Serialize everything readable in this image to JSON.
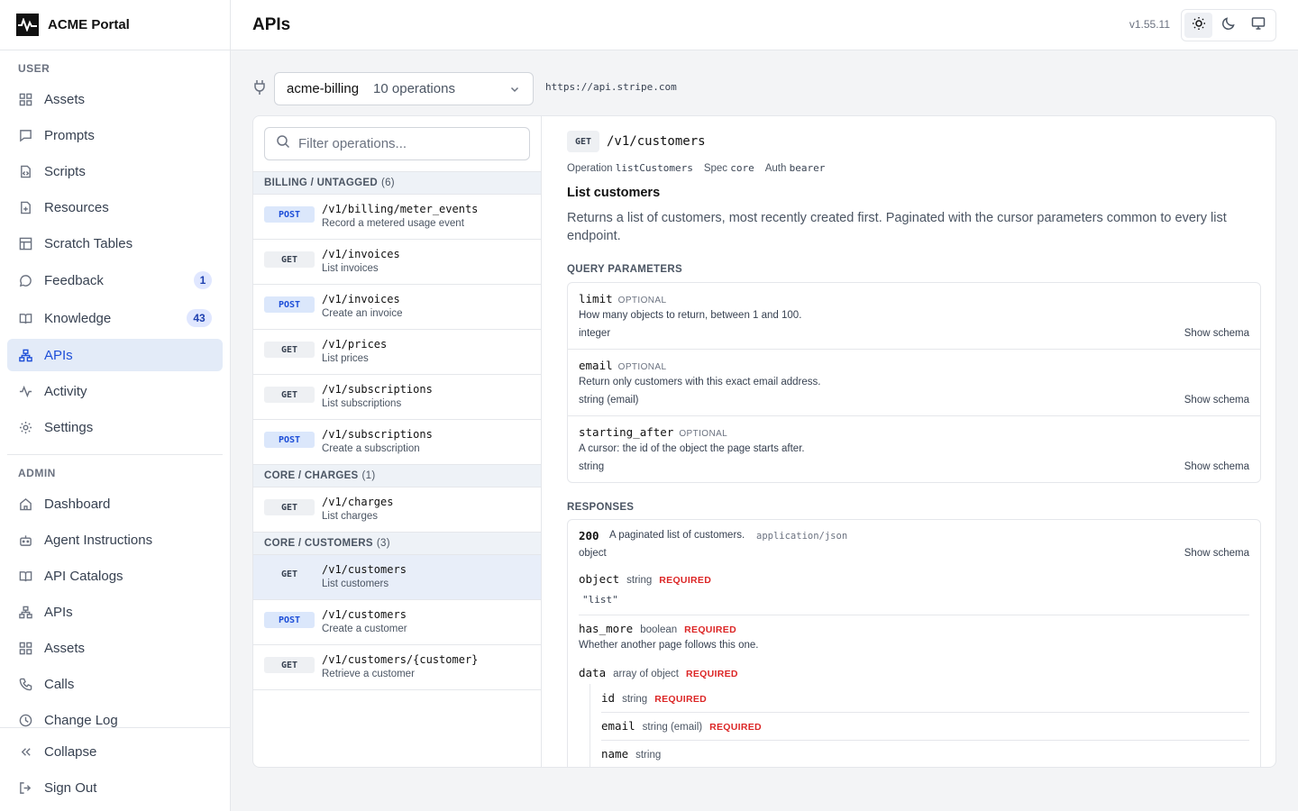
{
  "app": {
    "name": "ACME Portal",
    "version": "v1.55.11"
  },
  "sidebar": {
    "user_label": "USER",
    "admin_label": "ADMIN",
    "user_items": [
      {
        "label": "Assets",
        "icon": "grid-icon"
      },
      {
        "label": "Prompts",
        "icon": "message-square-icon"
      },
      {
        "label": "Scripts",
        "icon": "file-code-icon"
      },
      {
        "label": "Resources",
        "icon": "file-plus-icon"
      },
      {
        "label": "Scratch Tables",
        "icon": "table-icon"
      },
      {
        "label": "Feedback",
        "icon": "message-circle-icon",
        "badge": "1"
      },
      {
        "label": "Knowledge",
        "icon": "book-open-icon",
        "badge": "43"
      },
      {
        "label": "APIs",
        "icon": "network-icon",
        "active": true
      },
      {
        "label": "Activity",
        "icon": "activity-icon"
      },
      {
        "label": "Settings",
        "icon": "gear-icon"
      }
    ],
    "admin_items": [
      {
        "label": "Dashboard",
        "icon": "home-icon"
      },
      {
        "label": "Agent Instructions",
        "icon": "bot-icon"
      },
      {
        "label": "API Catalogs",
        "icon": "book-open-icon"
      },
      {
        "label": "APIs",
        "icon": "network-icon"
      },
      {
        "label": "Assets",
        "icon": "grid-icon"
      },
      {
        "label": "Calls",
        "icon": "phone-icon"
      },
      {
        "label": "Change Log",
        "icon": "clock-icon"
      }
    ],
    "collapse_label": "Collapse",
    "signout_label": "Sign Out"
  },
  "header": {
    "title": "APIs"
  },
  "toolbar": {
    "catalog_name": "acme-billing",
    "catalog_ops": "10 operations",
    "base_url": "https://api.stripe.com"
  },
  "operations": {
    "filter_placeholder": "Filter operations...",
    "groups": [
      {
        "name": "BILLING / UNTAGGED",
        "count": "(6)",
        "ops": [
          {
            "method": "POST",
            "path": "/v1/billing/meter_events",
            "summary": "Record a metered usage event"
          },
          {
            "method": "GET",
            "path": "/v1/invoices",
            "summary": "List invoices"
          },
          {
            "method": "POST",
            "path": "/v1/invoices",
            "summary": "Create an invoice"
          },
          {
            "method": "GET",
            "path": "/v1/prices",
            "summary": "List prices"
          },
          {
            "method": "GET",
            "path": "/v1/subscriptions",
            "summary": "List subscriptions"
          },
          {
            "method": "POST",
            "path": "/v1/subscriptions",
            "summary": "Create a subscription"
          }
        ]
      },
      {
        "name": "CORE / CHARGES",
        "count": "(1)",
        "ops": [
          {
            "method": "GET",
            "path": "/v1/charges",
            "summary": "List charges"
          }
        ]
      },
      {
        "name": "CORE / CUSTOMERS",
        "count": "(3)",
        "ops": [
          {
            "method": "GET",
            "path": "/v1/customers",
            "summary": "List customers",
            "selected": true
          },
          {
            "method": "POST",
            "path": "/v1/customers",
            "summary": "Create a customer"
          },
          {
            "method": "GET",
            "path": "/v1/customers/{customer}",
            "summary": "Retrieve a customer"
          }
        ]
      }
    ]
  },
  "detail": {
    "method": "GET",
    "path": "/v1/customers",
    "operation_label": "Operation",
    "operation_id": "listCustomers",
    "spec_label": "Spec",
    "spec": "core",
    "auth_label": "Auth",
    "auth": "bearer",
    "title": "List customers",
    "description": "Returns a list of customers, most recently created first. Paginated with the cursor parameters common to every list endpoint.",
    "query_label": "QUERY PARAMETERS",
    "show_schema": "Show schema",
    "params": [
      {
        "name": "limit",
        "flag": "OPTIONAL",
        "desc": "How many objects to return, between 1 and 100.",
        "type": "integer"
      },
      {
        "name": "email",
        "flag": "OPTIONAL",
        "desc": "Return only customers with this exact email address.",
        "type": "string (email)"
      },
      {
        "name": "starting_after",
        "flag": "OPTIONAL",
        "desc": "A cursor: the id of the object the page starts after.",
        "type": "string"
      }
    ],
    "responses_label": "RESPONSES",
    "response": {
      "code": "200",
      "desc": "A paginated list of customers.",
      "content_type": "application/json",
      "type": "object",
      "fields": [
        {
          "name": "object",
          "type": "string",
          "req": "REQUIRED",
          "sub": "\"list\""
        },
        {
          "name": "has_more",
          "type": "boolean",
          "req": "REQUIRED",
          "sub": "Whether another page follows this one."
        },
        {
          "name": "data",
          "type": "array of object",
          "req": "REQUIRED"
        }
      ],
      "nested": [
        {
          "name": "id",
          "type": "string",
          "req": "REQUIRED"
        },
        {
          "name": "email",
          "type": "string (email)",
          "req": "REQUIRED"
        },
        {
          "name": "name",
          "type": "string",
          "req": ""
        }
      ]
    }
  }
}
